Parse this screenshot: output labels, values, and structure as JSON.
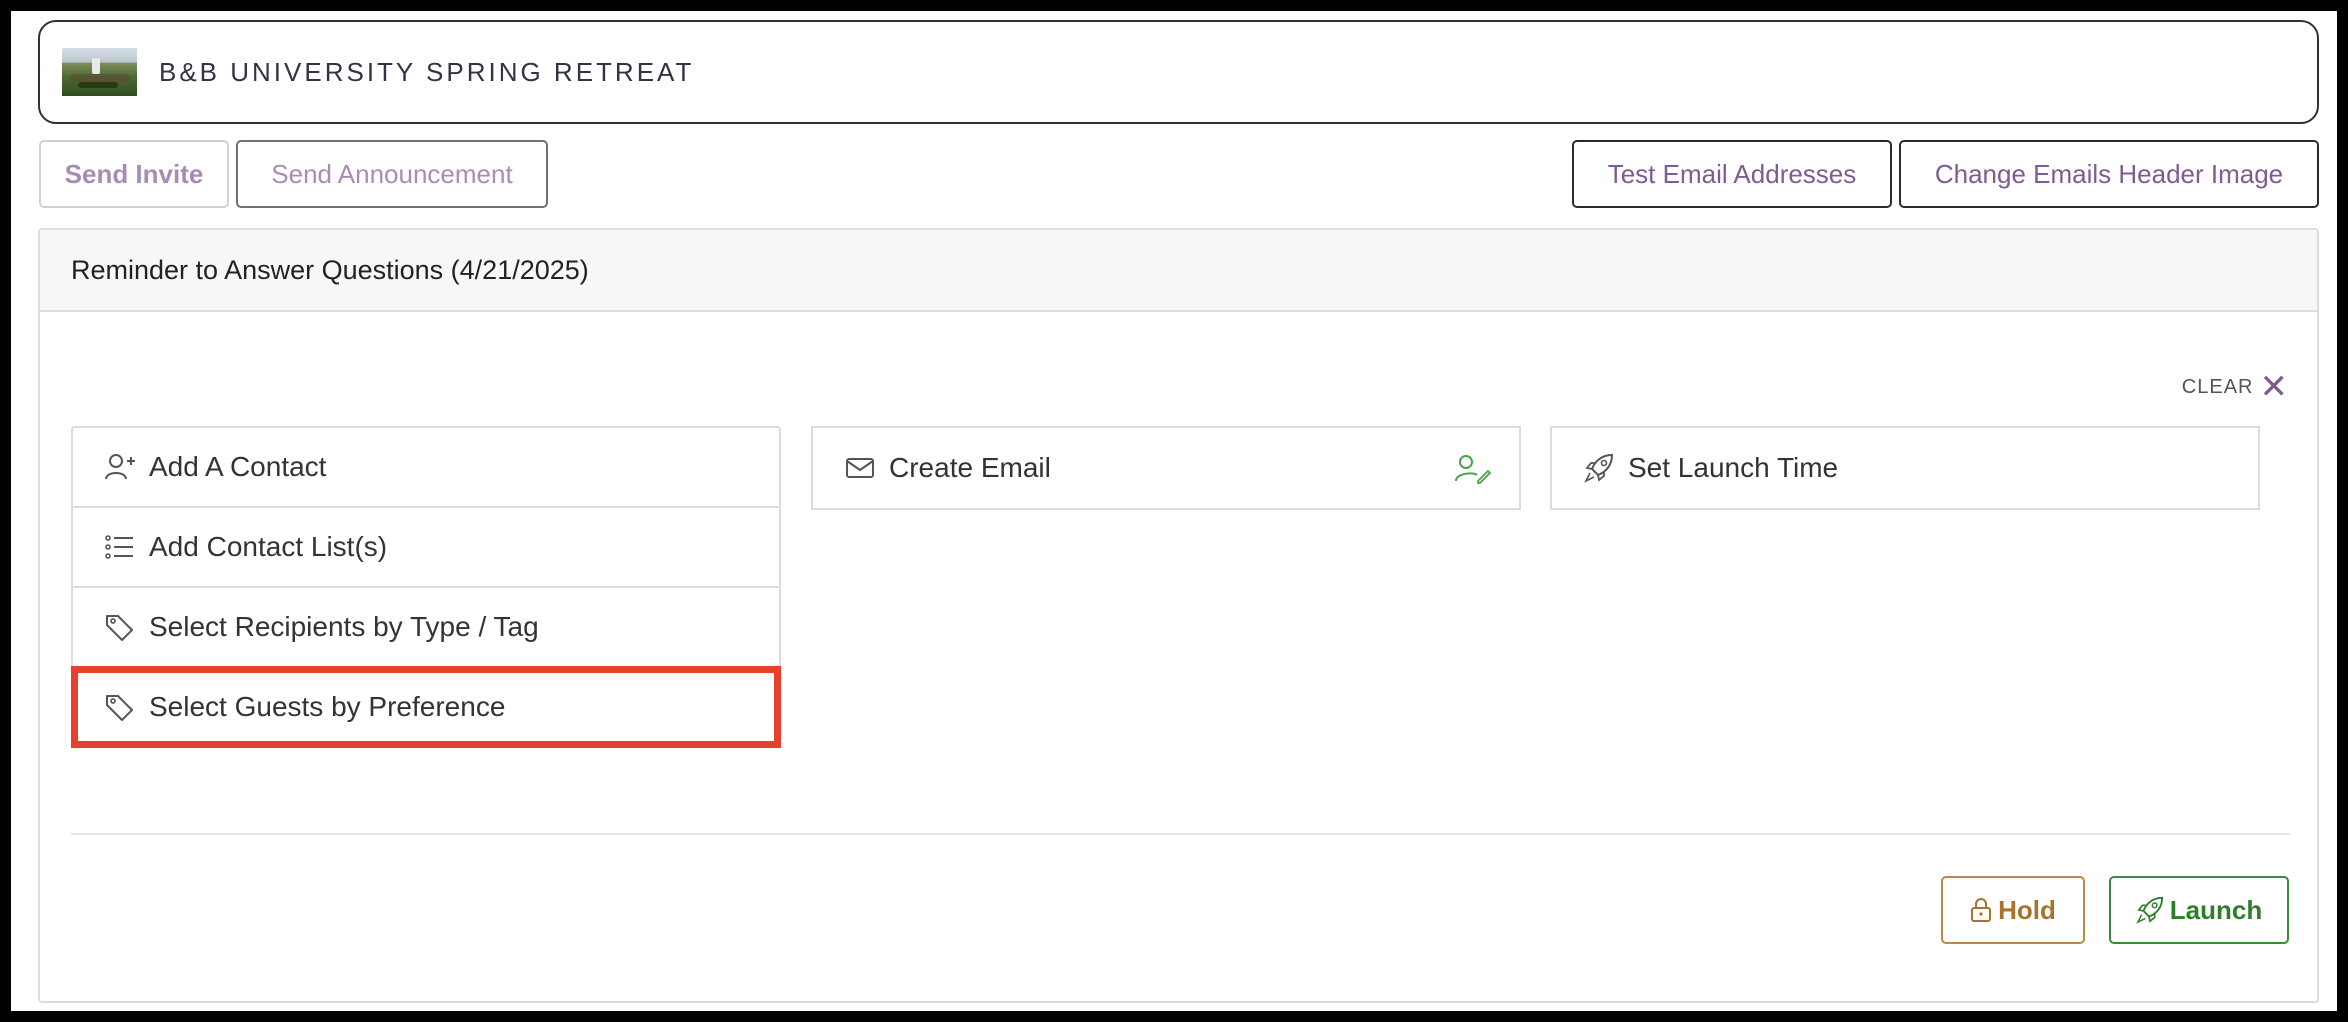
{
  "event": {
    "title": "B&B UNIVERSITY SPRING RETREAT",
    "thumbnail_icon": "event-thumbnail-image"
  },
  "toolbar": {
    "send_invite": "Send Invite",
    "send_announcement": "Send Announcement",
    "test_email_addresses": "Test Email Addresses",
    "change_emails_header_image": "Change Emails Header Image"
  },
  "panel": {
    "title": "Reminder to Answer Questions (4/21/2025)",
    "clear_label": "CLEAR",
    "clear_icon": "close-icon",
    "recipients": [
      {
        "label": "Add A Contact",
        "icon": "user-plus-icon"
      },
      {
        "label": "Add Contact List(s)",
        "icon": "list-icon"
      },
      {
        "label": "Select Recipients by Type / Tag",
        "icon": "tag-icon"
      },
      {
        "label": "Select Guests by Preference",
        "icon": "tag-icon",
        "highlighted": true
      }
    ],
    "create_email": {
      "label": "Create Email",
      "icon": "envelope-icon",
      "status_icon": "user-edit-icon"
    },
    "set_launch_time": {
      "label": "Set Launch Time",
      "icon": "rocket-icon"
    },
    "hold_button": "Hold",
    "launch_button": "Launch"
  },
  "colors": {
    "accent_purple": "#7f5a93",
    "muted_purple": "#a78db6",
    "highlight_red": "#e8402d",
    "hold_gold": "#a8732a",
    "launch_green": "#2f7d2a"
  }
}
